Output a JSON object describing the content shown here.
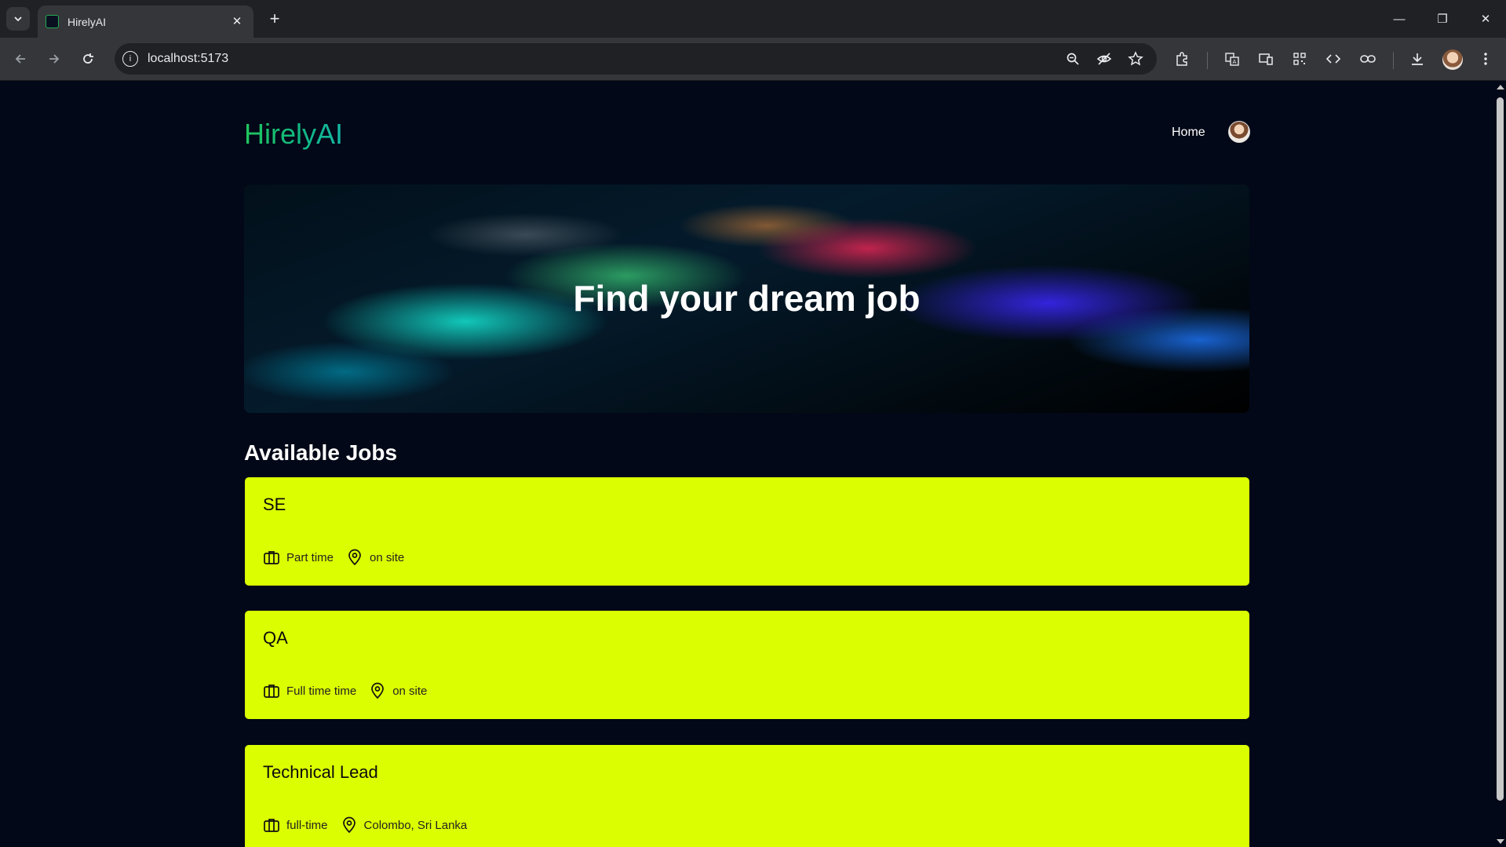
{
  "browser": {
    "tab_title": "HirelyAI",
    "url": "localhost:5173"
  },
  "header": {
    "brand": "HirelyAI",
    "nav_home": "Home"
  },
  "hero": {
    "title": "Find your dream job"
  },
  "section": {
    "title": "Available Jobs"
  },
  "jobs": [
    {
      "title": "SE",
      "type": "Part time",
      "location": "on site"
    },
    {
      "title": "QA",
      "type": "Full time time",
      "location": "on site"
    },
    {
      "title": "Technical Lead",
      "type": "full-time",
      "location": "Colombo, Sri Lanka"
    }
  ],
  "colors": {
    "page_bg": "#020817",
    "card_bg": "#dbff00",
    "brand_gradient_start": "#22c55e",
    "brand_gradient_end": "#14b8a6"
  }
}
